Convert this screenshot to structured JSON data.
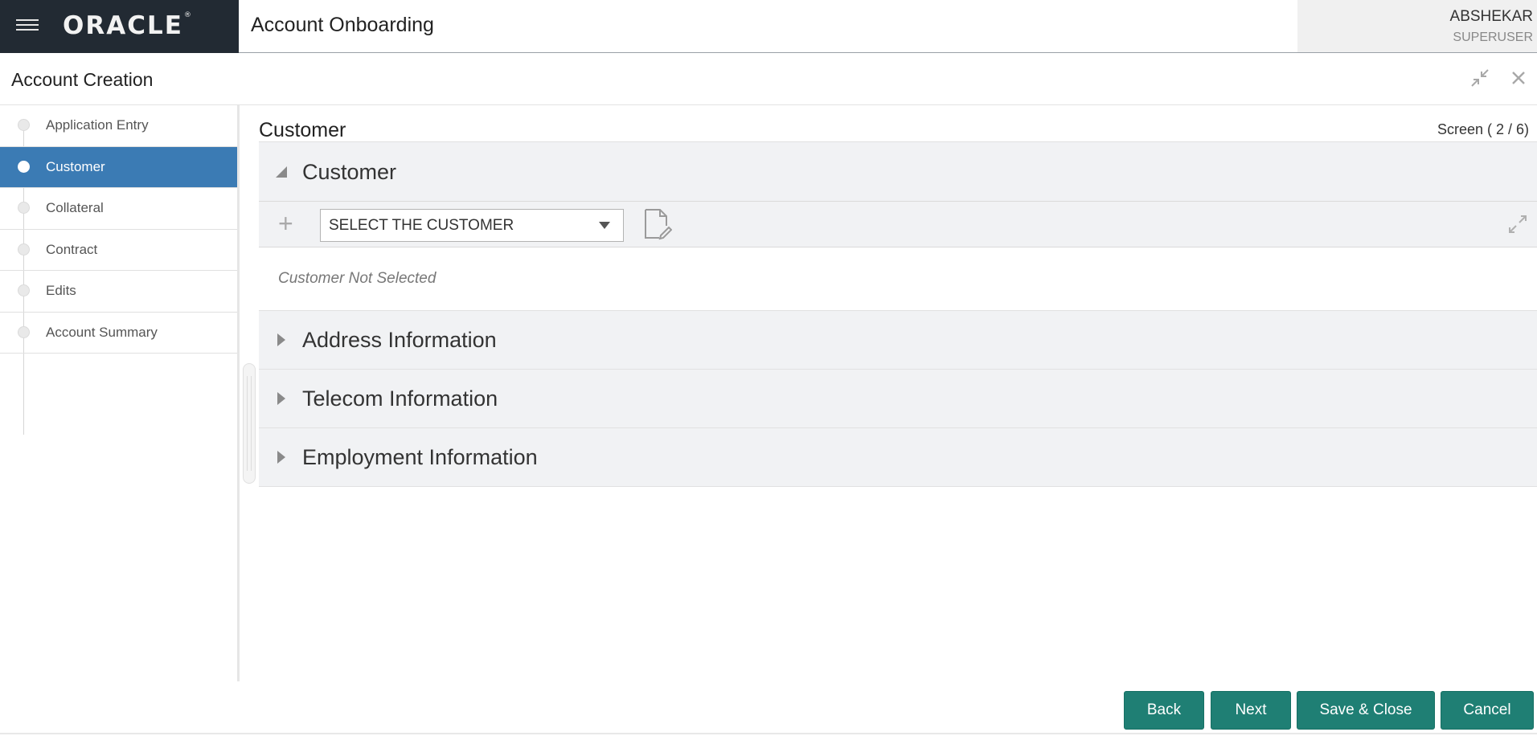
{
  "header": {
    "logo": "ORACLE",
    "logo_mark": "®",
    "app_title": "Account Onboarding",
    "user_name": "ABSHEKAR",
    "user_role": "SUPERUSER"
  },
  "subheader": {
    "title": "Account Creation"
  },
  "nav": {
    "items": [
      {
        "label": "Application Entry",
        "active": false
      },
      {
        "label": "Customer",
        "active": true
      },
      {
        "label": "Collateral",
        "active": false
      },
      {
        "label": "Contract",
        "active": false
      },
      {
        "label": "Edits",
        "active": false
      },
      {
        "label": "Account Summary",
        "active": false
      }
    ]
  },
  "main": {
    "title": "Customer",
    "screen_indicator": "Screen ( 2 / 6)",
    "customer_section": {
      "title": "Customer",
      "select_value": "SELECT THE CUSTOMER",
      "empty_message": "Customer Not Selected"
    },
    "sections": [
      {
        "title": "Address Information"
      },
      {
        "title": "Telecom Information"
      },
      {
        "title": "Employment Information"
      }
    ]
  },
  "footer": {
    "back": "Back",
    "next": "Next",
    "save_close": "Save & Close",
    "cancel": "Cancel"
  },
  "colors": {
    "brand_bg": "#222a33",
    "nav_active": "#3b7bb4",
    "button": "#1f7f74"
  }
}
